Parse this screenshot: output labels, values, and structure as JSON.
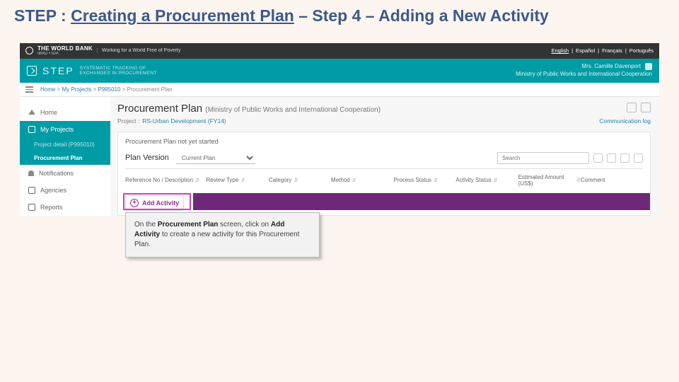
{
  "slide_title": {
    "prefix": "STEP : ",
    "underlined": "Creating a Procurement Plan",
    "mid": " – Step 4 – ",
    "suffix": "Adding a New Activity"
  },
  "wb_bar": {
    "name": "THE WORLD BANK",
    "sub": "IBRD • IDA",
    "tagline": "Working for a World Free of Poverty",
    "langs": [
      "English",
      "Español",
      "Français",
      "Português"
    ]
  },
  "step_bar": {
    "brand": "STEP",
    "tagline1": "SYSTEMATIC TRACKING OF",
    "tagline2": "EXCHANGES IN PROCUREMENT",
    "user_name": "Mrs. Camille Davenport",
    "user_org": "Ministry of Public Works and International Cooperation"
  },
  "breadcrumb": {
    "home": "Home",
    "proj": "My Projects",
    "pid": "P995010",
    "current": "Procurement Plan"
  },
  "sidebar": {
    "home": "Home",
    "my_projects": "My Projects",
    "project_detail": "Project detail (P995010)",
    "proc_plan": "Procurement Plan",
    "notifications": "Notifications",
    "agencies": "Agencies",
    "reports": "Reports"
  },
  "main": {
    "title": "Procurement Plan",
    "ministry": "(Ministry of Public Works and International Cooperation)",
    "project_label": "Project :",
    "project_link": "RS-Urban Development (FY14)",
    "comm_log": "Communication log",
    "not_started": "Procurement Plan not yet started",
    "plan_version_label": "Plan Version",
    "plan_version_value": "Current Plan",
    "search_placeholder": "Search",
    "columns": [
      "Reference No / Description",
      "Review Type",
      "Category",
      "Method",
      "Process Status",
      "Activity Status",
      "Estimated Amount (US$)",
      "Comment"
    ],
    "add_activity": "Add Activity"
  },
  "callout": {
    "t1": "On the ",
    "b1": "Procurement Plan",
    "t2": " screen, click on ",
    "b2": "Add Activity",
    "t3": " to create a new activity for this Procurement Plan."
  }
}
